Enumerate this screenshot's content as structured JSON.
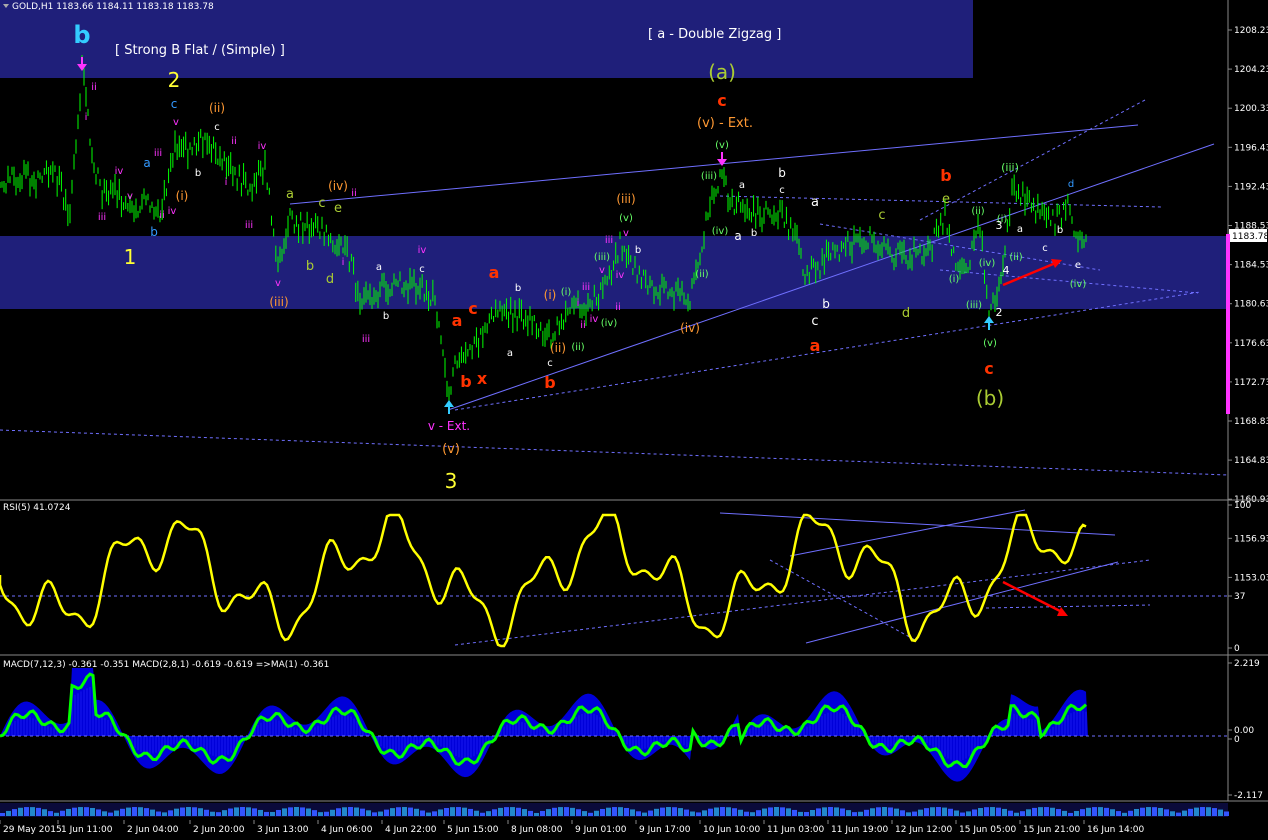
{
  "window": {
    "symbol_header": "GOLD,H1  1183.66 1184.11 1183.18 1183.78"
  },
  "colors": {
    "background": "#000000",
    "price_line": "#00ff00",
    "band": "#1f1f7a",
    "rsi_line": "#ffff00",
    "macd_hist": "#0000ff",
    "macd_signal": "#00ff00",
    "trend_line": "#6f6fff",
    "arrow_red": "#ff0000",
    "wave_red": "#ff3300",
    "wave_yellow": "#ffff33",
    "wave_orange": "#ff9933",
    "wave_magenta": "#ff33ff",
    "wave_green": "#66ff66",
    "wave_white": "#ffffff",
    "wave_olive": "#aacc33",
    "wave_blue": "#3399ff",
    "wave_cyan": "#33ccff"
  },
  "main_panel": {
    "banner_left": "[ Strong B Flat / (Simple) ]",
    "banner_right": "[ a - Double Zigzag ]",
    "current_price_tag": "1183.78",
    "y_axis_labels": [
      "1208.23",
      "1204.23",
      "1200.33",
      "1196.43",
      "1192.43",
      "1188.53",
      "1184.53",
      "1180.63",
      "1176.63",
      "1172.73",
      "1168.83",
      "1164.83",
      "1160.93",
      "1156.93",
      "1153.03"
    ]
  },
  "rsi_panel": {
    "header": "RSI(5) 41.0724",
    "y_axis_labels": [
      "100",
      "37",
      "0"
    ]
  },
  "macd_panel": {
    "header": "MACD(7,12,3) -0.361 -0.351  MACD(2,8,1) -0.619 -0.619  =>MA(1) -0.361",
    "y_axis_labels": [
      "2.219",
      "0.00",
      "0",
      "-2.117"
    ]
  },
  "x_axis_labels": [
    "29 May 2015",
    "1 Jun 11:00",
    "2 Jun 04:00",
    "2 Jun 20:00",
    "3 Jun 13:00",
    "4 Jun 06:00",
    "4 Jun 22:00",
    "5 Jun 15:00",
    "8 Jun 08:00",
    "9 Jun 01:00",
    "9 Jun 17:00",
    "10 Jun 10:00",
    "11 Jun 03:00",
    "11 Jun 19:00",
    "12 Jun 12:00",
    "15 Jun 05:00",
    "15 Jun 21:00",
    "16 Jun 14:00"
  ],
  "wave_labels": [
    {
      "t": "b",
      "c": "wave_cyan",
      "x": 82,
      "y": 43,
      "s": 24,
      "w": "bold"
    },
    {
      "t": "2",
      "c": "wave_yellow",
      "x": 174,
      "y": 87,
      "s": 20
    },
    {
      "t": "1",
      "c": "wave_yellow",
      "x": 130,
      "y": 264,
      "s": 20
    },
    {
      "t": "3",
      "c": "wave_yellow",
      "x": 451,
      "y": 488,
      "s": 20
    },
    {
      "t": "(a)",
      "c": "wave_olive",
      "x": 722,
      "y": 79,
      "s": 20
    },
    {
      "t": "(b)",
      "c": "wave_olive",
      "x": 990,
      "y": 405,
      "s": 20
    },
    {
      "t": "c",
      "c": "wave_red",
      "x": 722,
      "y": 106,
      "s": 16,
      "w": "bold"
    },
    {
      "t": "(v) - Ext.",
      "c": "wave_orange",
      "x": 725,
      "y": 127,
      "s": 13
    },
    {
      "t": "b",
      "c": "wave_red",
      "x": 946,
      "y": 181,
      "s": 16,
      "w": "bold"
    },
    {
      "t": "c",
      "c": "wave_red",
      "x": 989,
      "y": 374,
      "s": 16,
      "w": "bold"
    },
    {
      "t": "a",
      "c": "wave_red",
      "x": 494,
      "y": 278,
      "s": 16,
      "w": "bold"
    },
    {
      "t": "a",
      "c": "wave_red",
      "x": 457,
      "y": 326,
      "s": 16,
      "w": "bold"
    },
    {
      "t": "c",
      "c": "wave_red",
      "x": 473,
      "y": 314,
      "s": 16,
      "w": "bold"
    },
    {
      "t": "b",
      "c": "wave_red",
      "x": 466,
      "y": 387,
      "s": 16,
      "w": "bold"
    },
    {
      "t": "x",
      "c": "wave_red",
      "x": 482,
      "y": 384,
      "s": 16,
      "w": "bold"
    },
    {
      "t": "b",
      "c": "wave_red",
      "x": 550,
      "y": 388,
      "s": 16,
      "w": "bold"
    },
    {
      "t": "a",
      "c": "wave_red",
      "x": 815,
      "y": 351,
      "s": 16,
      "w": "bold"
    },
    {
      "t": "v - Ext.",
      "c": "wave_magenta",
      "x": 449,
      "y": 430,
      "s": 12
    },
    {
      "t": "(v)",
      "c": "wave_orange",
      "x": 451,
      "y": 453,
      "s": 13
    },
    {
      "t": "(ii)",
      "c": "wave_orange",
      "x": 217,
      "y": 112,
      "s": 12
    },
    {
      "t": "(i)",
      "c": "wave_orange",
      "x": 182,
      "y": 200,
      "s": 12
    },
    {
      "t": "(iv)",
      "c": "wave_orange",
      "x": 338,
      "y": 190,
      "s": 12
    },
    {
      "t": "(iii)",
      "c": "wave_orange",
      "x": 279,
      "y": 306,
      "s": 12
    },
    {
      "t": "(iii)",
      "c": "wave_orange",
      "x": 626,
      "y": 203,
      "s": 12
    },
    {
      "t": "(i)",
      "c": "wave_orange",
      "x": 550,
      "y": 299,
      "s": 12
    },
    {
      "t": "(ii)",
      "c": "wave_orange",
      "x": 558,
      "y": 352,
      "s": 12
    },
    {
      "t": "(iv)",
      "c": "wave_orange",
      "x": 690,
      "y": 332,
      "s": 12
    },
    {
      "t": "c",
      "c": "wave_blue",
      "x": 174,
      "y": 108,
      "s": 12
    },
    {
      "t": "a",
      "c": "wave_blue",
      "x": 147,
      "y": 167,
      "s": 12
    },
    {
      "t": "b",
      "c": "wave_blue",
      "x": 154,
      "y": 236,
      "s": 12
    },
    {
      "t": "ii",
      "c": "wave_magenta",
      "x": 94,
      "y": 90,
      "s": 10
    },
    {
      "t": "i",
      "c": "wave_magenta",
      "x": 86,
      "y": 120,
      "s": 10
    },
    {
      "t": "iv",
      "c": "wave_magenta",
      "x": 119,
      "y": 174,
      "s": 10
    },
    {
      "t": "v",
      "c": "wave_magenta",
      "x": 130,
      "y": 199,
      "s": 10
    },
    {
      "t": "iii",
      "c": "wave_magenta",
      "x": 102,
      "y": 220,
      "s": 10
    },
    {
      "t": "iii",
      "c": "wave_magenta",
      "x": 158,
      "y": 156,
      "s": 10
    },
    {
      "t": "iv",
      "c": "wave_magenta",
      "x": 172,
      "y": 214,
      "s": 10
    },
    {
      "t": "ii",
      "c": "wave_magenta",
      "x": 162,
      "y": 218,
      "s": 10
    },
    {
      "t": "v",
      "c": "wave_magenta",
      "x": 176,
      "y": 125,
      "s": 10
    },
    {
      "t": "c",
      "c": "wave_white",
      "x": 217,
      "y": 130,
      "s": 10
    },
    {
      "t": "b",
      "c": "wave_white",
      "x": 198,
      "y": 176,
      "s": 10
    },
    {
      "t": "ii",
      "c": "wave_magenta",
      "x": 234,
      "y": 144,
      "s": 10
    },
    {
      "t": "i",
      "c": "wave_magenta",
      "x": 226,
      "y": 185,
      "s": 10
    },
    {
      "t": "iii",
      "c": "wave_magenta",
      "x": 249,
      "y": 228,
      "s": 10
    },
    {
      "t": "iv",
      "c": "wave_magenta",
      "x": 262,
      "y": 149,
      "s": 10
    },
    {
      "t": "v",
      "c": "wave_magenta",
      "x": 278,
      "y": 286,
      "s": 10
    },
    {
      "t": "a",
      "c": "wave_olive",
      "x": 290,
      "y": 198,
      "s": 13
    },
    {
      "t": "b",
      "c": "wave_olive",
      "x": 310,
      "y": 270,
      "s": 13
    },
    {
      "t": "c",
      "c": "wave_olive",
      "x": 322,
      "y": 207,
      "s": 13
    },
    {
      "t": "e",
      "c": "wave_olive",
      "x": 338,
      "y": 212,
      "s": 13
    },
    {
      "t": "d",
      "c": "wave_olive",
      "x": 330,
      "y": 283,
      "s": 13
    },
    {
      "t": "ii",
      "c": "wave_magenta",
      "x": 354,
      "y": 196,
      "s": 10
    },
    {
      "t": "i",
      "c": "wave_magenta",
      "x": 343,
      "y": 265,
      "s": 10
    },
    {
      "t": "iii",
      "c": "wave_magenta",
      "x": 366,
      "y": 342,
      "s": 10
    },
    {
      "t": "iv",
      "c": "wave_magenta",
      "x": 422,
      "y": 253,
      "s": 10
    },
    {
      "t": "c",
      "c": "wave_white",
      "x": 422,
      "y": 272,
      "s": 10
    },
    {
      "t": "a",
      "c": "wave_white",
      "x": 379,
      "y": 270,
      "s": 10
    },
    {
      "t": "b",
      "c": "wave_white",
      "x": 386,
      "y": 319,
      "s": 10
    },
    {
      "t": "b",
      "c": "wave_white",
      "x": 518,
      "y": 291,
      "s": 10
    },
    {
      "t": "a",
      "c": "wave_white",
      "x": 510,
      "y": 356,
      "s": 10
    },
    {
      "t": "c",
      "c": "wave_white",
      "x": 550,
      "y": 366,
      "s": 10
    },
    {
      "t": "(i)",
      "c": "wave_green",
      "x": 566,
      "y": 295,
      "s": 10
    },
    {
      "t": "(ii)",
      "c": "wave_green",
      "x": 578,
      "y": 350,
      "s": 10
    },
    {
      "t": "iii",
      "c": "wave_magenta",
      "x": 586,
      "y": 290,
      "s": 10
    },
    {
      "t": "i",
      "c": "wave_magenta",
      "x": 578,
      "y": 306,
      "s": 10
    },
    {
      "t": "iv",
      "c": "wave_magenta",
      "x": 594,
      "y": 322,
      "s": 10
    },
    {
      "t": "ii",
      "c": "wave_magenta",
      "x": 583,
      "y": 328,
      "s": 10
    },
    {
      "t": "(iii)",
      "c": "wave_green",
      "x": 602,
      "y": 260,
      "s": 10
    },
    {
      "t": "(iv)",
      "c": "wave_green",
      "x": 609,
      "y": 326,
      "s": 10
    },
    {
      "t": "(v)",
      "c": "wave_green",
      "x": 626,
      "y": 221,
      "s": 10
    },
    {
      "t": "v",
      "c": "wave_magenta",
      "x": 626,
      "y": 236,
      "s": 10
    },
    {
      "t": "iii",
      "c": "wave_magenta",
      "x": 609,
      "y": 243,
      "s": 10
    },
    {
      "t": "v",
      "c": "wave_magenta",
      "x": 602,
      "y": 273,
      "s": 10
    },
    {
      "t": "iv",
      "c": "wave_magenta",
      "x": 620,
      "y": 278,
      "s": 10
    },
    {
      "t": "ii",
      "c": "wave_magenta",
      "x": 618,
      "y": 310,
      "s": 10
    },
    {
      "t": "b",
      "c": "wave_white",
      "x": 638,
      "y": 253,
      "s": 10
    },
    {
      "t": "(v)",
      "c": "wave_green",
      "x": 722,
      "y": 148,
      "s": 10
    },
    {
      "t": "(iii)",
      "c": "wave_green",
      "x": 709,
      "y": 179,
      "s": 10
    },
    {
      "t": "(iv)",
      "c": "wave_green",
      "x": 720,
      "y": 234,
      "s": 10
    },
    {
      "t": "(ii)",
      "c": "wave_green",
      "x": 702,
      "y": 277,
      "s": 10
    },
    {
      "t": "a",
      "c": "wave_white",
      "x": 742,
      "y": 188,
      "s": 10
    },
    {
      "t": "a",
      "c": "wave_white",
      "x": 738,
      "y": 240,
      "s": 12
    },
    {
      "t": "b",
      "c": "wave_white",
      "x": 754,
      "y": 236,
      "s": 10
    },
    {
      "t": "b",
      "c": "wave_white",
      "x": 782,
      "y": 177,
      "s": 12
    },
    {
      "t": "c",
      "c": "wave_white",
      "x": 782,
      "y": 193,
      "s": 10
    },
    {
      "t": "a",
      "c": "wave_white",
      "x": 815,
      "y": 206,
      "s": 13
    },
    {
      "t": "b",
      "c": "wave_white",
      "x": 826,
      "y": 308,
      "s": 12
    },
    {
      "t": "c",
      "c": "wave_white",
      "x": 815,
      "y": 325,
      "s": 13
    },
    {
      "t": "c",
      "c": "wave_olive",
      "x": 882,
      "y": 219,
      "s": 13
    },
    {
      "t": "d",
      "c": "wave_olive",
      "x": 906,
      "y": 317,
      "s": 13
    },
    {
      "t": "e",
      "c": "wave_olive",
      "x": 946,
      "y": 203,
      "s": 13
    },
    {
      "t": "(iii)",
      "c": "wave_green",
      "x": 1010,
      "y": 171,
      "s": 11
    },
    {
      "t": "(ii)",
      "c": "wave_green",
      "x": 978,
      "y": 214,
      "s": 10
    },
    {
      "t": "(i)",
      "c": "wave_green",
      "x": 954,
      "y": 282,
      "s": 10
    },
    {
      "t": "(iii)",
      "c": "wave_green",
      "x": 974,
      "y": 308,
      "s": 10
    },
    {
      "t": "(iv)",
      "c": "wave_green",
      "x": 987,
      "y": 266,
      "s": 10
    },
    {
      "t": "(i)",
      "c": "wave_green",
      "x": 1002,
      "y": 222,
      "s": 10
    },
    {
      "t": "(ii)",
      "c": "wave_green",
      "x": 1016,
      "y": 260,
      "s": 10
    },
    {
      "t": "(v)",
      "c": "wave_green",
      "x": 990,
      "y": 346,
      "s": 10
    },
    {
      "t": "3",
      "c": "wave_white",
      "x": 999,
      "y": 229,
      "s": 11
    },
    {
      "t": "4",
      "c": "wave_white",
      "x": 1006,
      "y": 274,
      "s": 11
    },
    {
      "t": "2",
      "c": "wave_white",
      "x": 999,
      "y": 316,
      "s": 11
    },
    {
      "t": "a",
      "c": "wave_white",
      "x": 1020,
      "y": 232,
      "s": 10
    },
    {
      "t": "c",
      "c": "wave_white",
      "x": 1045,
      "y": 251,
      "s": 10
    },
    {
      "t": "b",
      "c": "wave_white",
      "x": 1060,
      "y": 233,
      "s": 10
    },
    {
      "t": "d",
      "c": "wave_blue",
      "x": 1071,
      "y": 187,
      "s": 10
    },
    {
      "t": "e",
      "c": "wave_white",
      "x": 1078,
      "y": 268,
      "s": 10
    },
    {
      "t": "(iv)",
      "c": "wave_green",
      "x": 1078,
      "y": 287,
      "s": 10
    }
  ],
  "chart_data": [
    {
      "type": "line",
      "title": "GOLD,H1",
      "xlabel": "",
      "ylabel": "",
      "ylim": [
        1153.03,
        1208.23
      ],
      "x": [
        "29 May 2015",
        "1 Jun 11:00",
        "2 Jun 04:00",
        "2 Jun 20:00",
        "3 Jun 13:00",
        "4 Jun 06:00",
        "4 Jun 22:00",
        "5 Jun 15:00",
        "8 Jun 08:00",
        "9 Jun 01:00",
        "9 Jun 17:00",
        "10 Jun 10:00",
        "11 Jun 03:00",
        "11 Jun 19:00",
        "12 Jun 12:00",
        "15 Jun 05:00",
        "15 Jun 21:00",
        "16 Jun 14:00"
      ],
      "values": [
        1189.5,
        1189.0,
        1195.2,
        1193.0,
        1183.0,
        1181.5,
        1174.5,
        1170.0,
        1173.5,
        1177.5,
        1175.0,
        1189.0,
        1182.5,
        1182.0,
        1180.0,
        1175.0,
        1187.5,
        1183.78
      ],
      "last": {
        "open": 1183.66,
        "high": 1184.11,
        "low": 1183.18,
        "close": 1183.78
      }
    },
    {
      "type": "line",
      "title": "RSI(5)",
      "ylim": [
        0,
        100
      ],
      "levels": [
        37
      ],
      "x": [
        "29 May 2015",
        "1 Jun 11:00",
        "2 Jun 04:00",
        "2 Jun 20:00",
        "3 Jun 13:00",
        "4 Jun 06:00",
        "4 Jun 22:00",
        "5 Jun 15:00",
        "8 Jun 08:00",
        "9 Jun 01:00",
        "9 Jun 17:00",
        "10 Jun 10:00",
        "11 Jun 03:00",
        "11 Jun 19:00",
        "12 Jun 12:00",
        "15 Jun 05:00",
        "15 Jun 21:00",
        "16 Jun 14:00"
      ],
      "values": [
        55,
        48,
        72,
        66,
        48,
        40,
        35,
        22,
        60,
        70,
        45,
        88,
        50,
        62,
        55,
        40,
        70,
        41.0724
      ]
    },
    {
      "type": "bar",
      "title": "MACD(7,12,3) / MACD(2,8,1)",
      "ylim": [
        -2.117,
        2.219
      ],
      "series": [
        {
          "name": "MACD(7,12,3)",
          "values": [
            0.2,
            1.2,
            0.6,
            0.2,
            -0.3,
            -0.6,
            -0.9,
            -1.5,
            0.5,
            0.6,
            -0.2,
            1.3,
            -0.6,
            -0.1,
            0.3,
            -0.7,
            1.1,
            -0.361
          ]
        },
        {
          "name": "MACD(2,8,1)",
          "values": [
            0.1,
            2.2,
            0.1,
            0.3,
            -0.4,
            -0.9,
            -1.0,
            -2.0,
            0.8,
            0.7,
            -0.3,
            1.4,
            -0.8,
            -0.2,
            0.5,
            -0.9,
            0.9,
            -0.619
          ]
        }
      ],
      "last": {
        "macd_7_12_3": -0.361,
        "signal_7_12_3": -0.351,
        "macd_2_8_1": -0.619,
        "signal_2_8_1": -0.619,
        "ma1": -0.361
      }
    }
  ]
}
